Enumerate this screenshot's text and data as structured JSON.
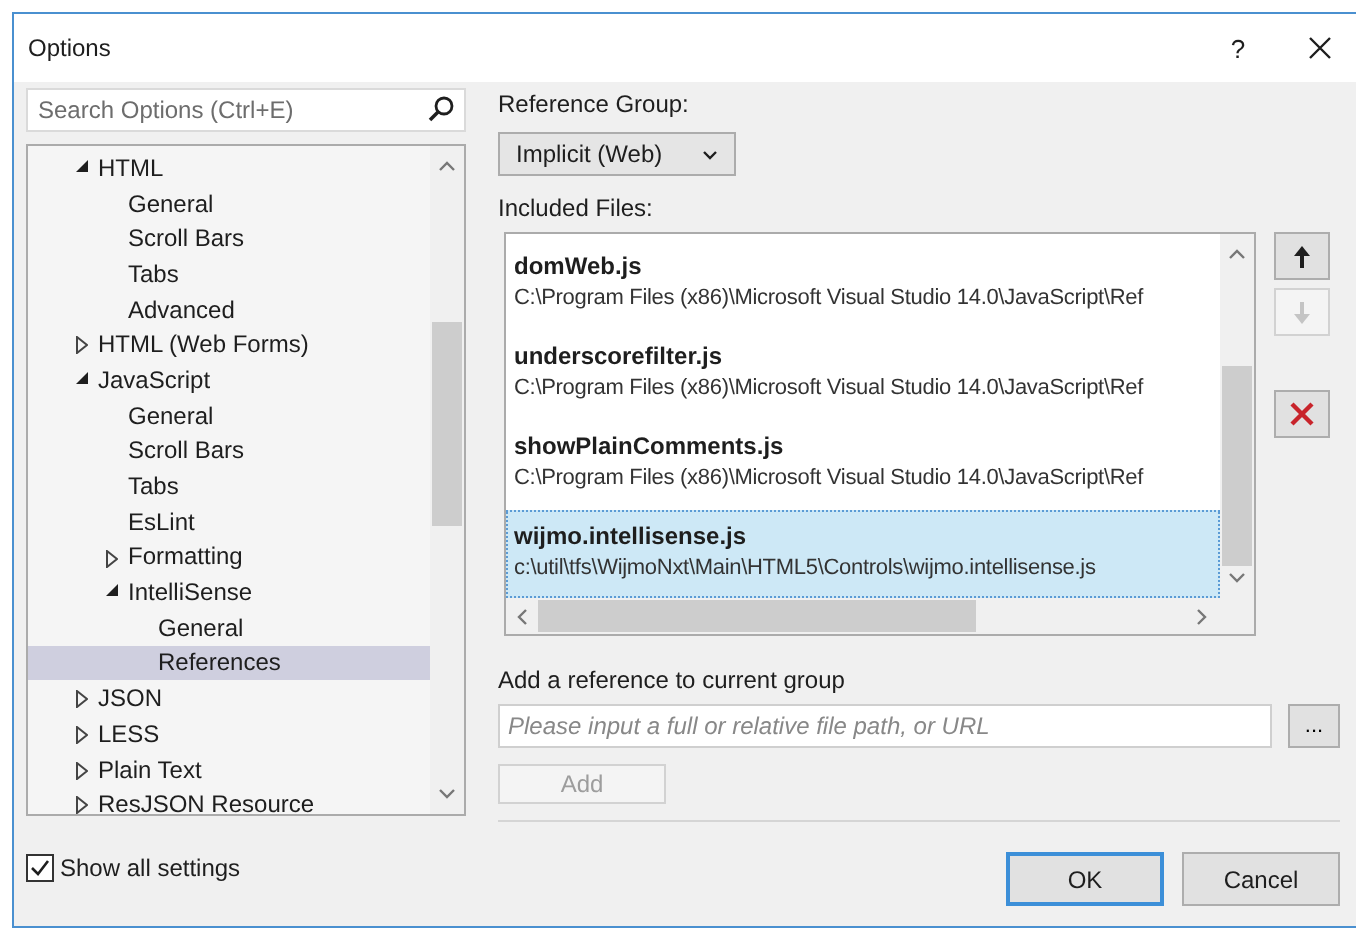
{
  "window": {
    "title": "Options",
    "help": "?"
  },
  "search": {
    "placeholder": "Search Options (Ctrl+E)"
  },
  "tree": {
    "items": [
      {
        "label": "HTML",
        "expanded": true,
        "selected": false,
        "children": [
          {
            "label": "General",
            "selected": false
          },
          {
            "label": "Scroll Bars",
            "selected": false
          },
          {
            "label": "Tabs",
            "selected": false
          },
          {
            "label": "Advanced",
            "selected": false
          }
        ]
      },
      {
        "label": "HTML (Web Forms)",
        "expanded": false,
        "selected": false
      },
      {
        "label": "JavaScript",
        "expanded": true,
        "selected": false,
        "children": [
          {
            "label": "General",
            "selected": false
          },
          {
            "label": "Scroll Bars",
            "selected": false
          },
          {
            "label": "Tabs",
            "selected": false
          },
          {
            "label": "EsLint",
            "selected": false
          },
          {
            "label": "Formatting",
            "expanded": false,
            "selected": false
          },
          {
            "label": "IntelliSense",
            "expanded": true,
            "selected": false,
            "children": [
              {
                "label": "General",
                "selected": false
              },
              {
                "label": "References",
                "selected": true
              }
            ]
          }
        ]
      },
      {
        "label": "JSON",
        "expanded": false,
        "selected": false
      },
      {
        "label": "LESS",
        "expanded": false,
        "selected": false
      },
      {
        "label": "Plain Text",
        "expanded": false,
        "selected": false
      },
      {
        "label": "ResJSON Resource",
        "expanded": false,
        "selected": false
      }
    ]
  },
  "show_all_settings": {
    "label": "Show all settings",
    "checked": true
  },
  "reference_group": {
    "label": "Reference Group:",
    "value": "Implicit (Web)"
  },
  "included_files": {
    "label": "Included Files:",
    "files": [
      {
        "name": "domWeb.js",
        "path": "C:\\Program Files (x86)\\Microsoft Visual Studio 14.0\\JavaScript\\Ref",
        "selected": false
      },
      {
        "name": "underscorefilter.js",
        "path": "C:\\Program Files (x86)\\Microsoft Visual Studio 14.0\\JavaScript\\Ref",
        "selected": false
      },
      {
        "name": "showPlainComments.js",
        "path": "C:\\Program Files (x86)\\Microsoft Visual Studio 14.0\\JavaScript\\Ref",
        "selected": false
      },
      {
        "name": "wijmo.intellisense.js",
        "path": "c:\\util\\tfs\\WijmoNxt\\Main\\HTML5\\Controls\\wijmo.intellisense.js",
        "selected": true
      }
    ]
  },
  "side_buttons": [
    {
      "kind": "up",
      "disabled": false
    },
    {
      "kind": "down",
      "disabled": true
    },
    {
      "kind": "remove",
      "disabled": false
    }
  ],
  "add_reference": {
    "label": "Add a reference to current group",
    "placeholder": "Please input a full or relative file path, or URL",
    "browse": "...",
    "add": {
      "label": "Add",
      "disabled": true
    }
  },
  "footer_buttons": [
    {
      "label": "OK",
      "default": true
    },
    {
      "label": "Cancel",
      "default": false
    }
  ]
}
